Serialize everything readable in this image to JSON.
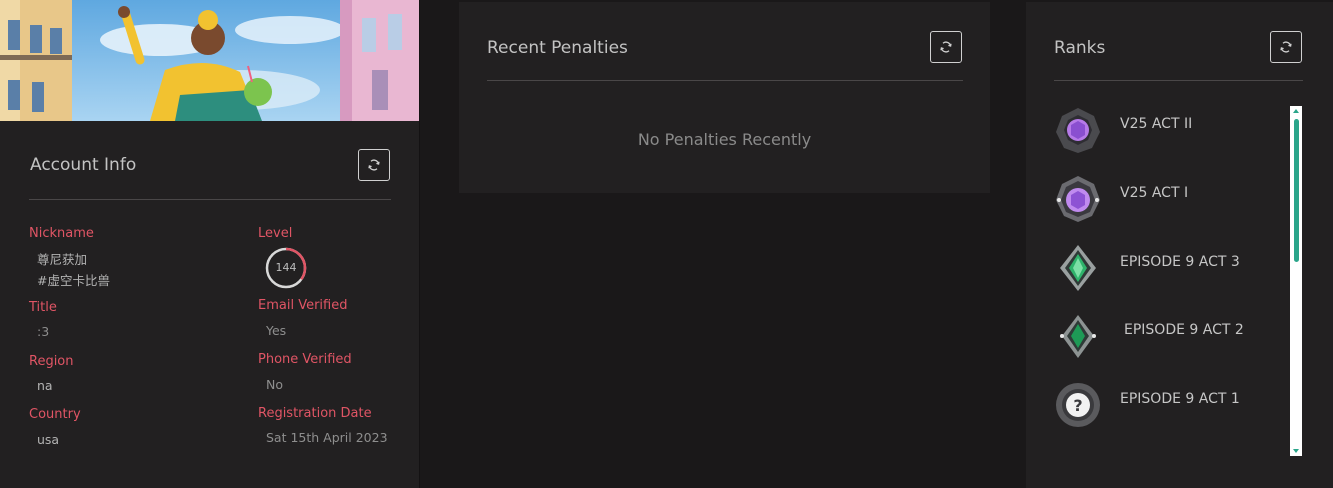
{
  "account": {
    "title": "Account Info",
    "fields": {
      "nickname": {
        "label": "Nickname",
        "value_name": "尊尼获加",
        "value_tag": "#虚空卡比兽"
      },
      "level": {
        "label": "Level",
        "value": "144",
        "progress": 0.35
      },
      "title": {
        "label": "Title",
        "value": ":3"
      },
      "email_verified": {
        "label": "Email Verified",
        "value": "Yes"
      },
      "phone_verified": {
        "label": "Phone Verified",
        "value": "No"
      },
      "region": {
        "label": "Region",
        "value": "na"
      },
      "country": {
        "label": "Country",
        "value": "usa"
      },
      "registration_date": {
        "label": "Registration Date",
        "value": "Sat 15th April 2023"
      }
    },
    "refresh_icon": "refresh-icon"
  },
  "penalties": {
    "title": "Recent Penalties",
    "empty_message": "No Penalties Recently",
    "refresh_icon": "refresh-icon"
  },
  "ranks": {
    "title": "Ranks",
    "refresh_icon": "refresh-icon",
    "items": [
      {
        "label": "V25 ACT II",
        "icon": "amethyst-rank-icon"
      },
      {
        "label": "V25 ACT I",
        "icon": "amethyst-rank-icon"
      },
      {
        "label": "EPISODE 9 ACT 3",
        "icon": "emerald-rank-icon"
      },
      {
        "label": "EPISODE 9 ACT 2",
        "icon": "emerald-rank-icon"
      },
      {
        "label": "EPISODE 9 ACT 1",
        "icon": "unranked-icon"
      }
    ]
  },
  "colors": {
    "label_red": "#e05565",
    "scroll_thumb": "#2aa58a",
    "background": "#1a1819",
    "panel": "#222021"
  }
}
